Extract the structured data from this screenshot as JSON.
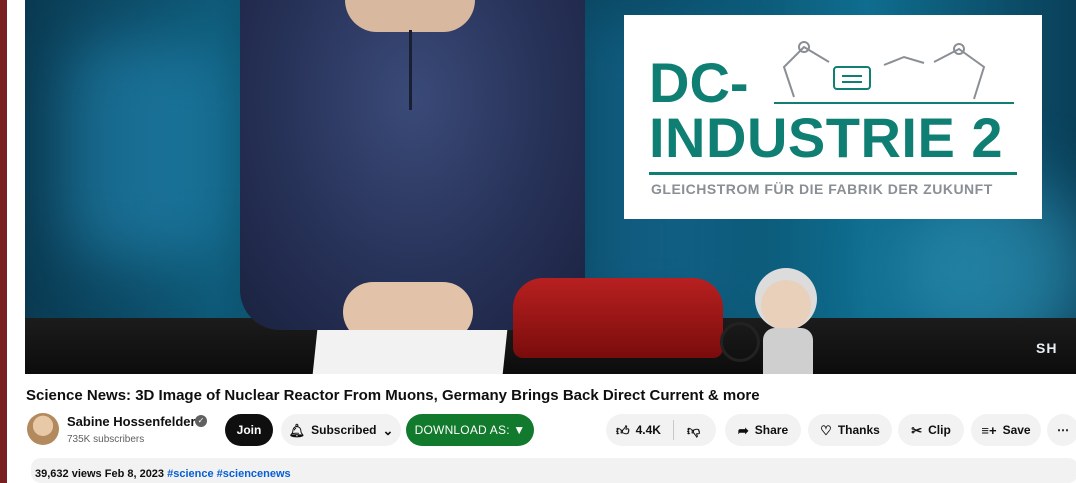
{
  "video": {
    "ad": {
      "line1": "DC-",
      "line2": "INDUSTRIE 2",
      "tagline": "GLEICHSTROM FÜR DIE FABRIK DER ZUKUNFT",
      "accent_color": "#0f7f73"
    },
    "watermark": "SH"
  },
  "title": "Science News: 3D Image of Nuclear Reactor From Muons, Germany Brings Back Direct Current & more",
  "channel": {
    "name": "Sabine Hossenfelder",
    "verified_icon": "check-circle-icon",
    "subscribers": "735K subscribers"
  },
  "actions": {
    "join": "Join",
    "subscribed": "Subscribed",
    "download": "DOWNLOAD AS: ▼",
    "likes": "4.4K",
    "share": "Share",
    "thanks": "Thanks",
    "clip": "Clip",
    "save": "Save",
    "more": "⋯"
  },
  "description": {
    "views": "39,632 views",
    "date": "Feb 8, 2023",
    "hashtags": "#science #sciencenews"
  },
  "colors": {
    "download_green": "#117a2c",
    "link_blue": "#065fd4"
  }
}
